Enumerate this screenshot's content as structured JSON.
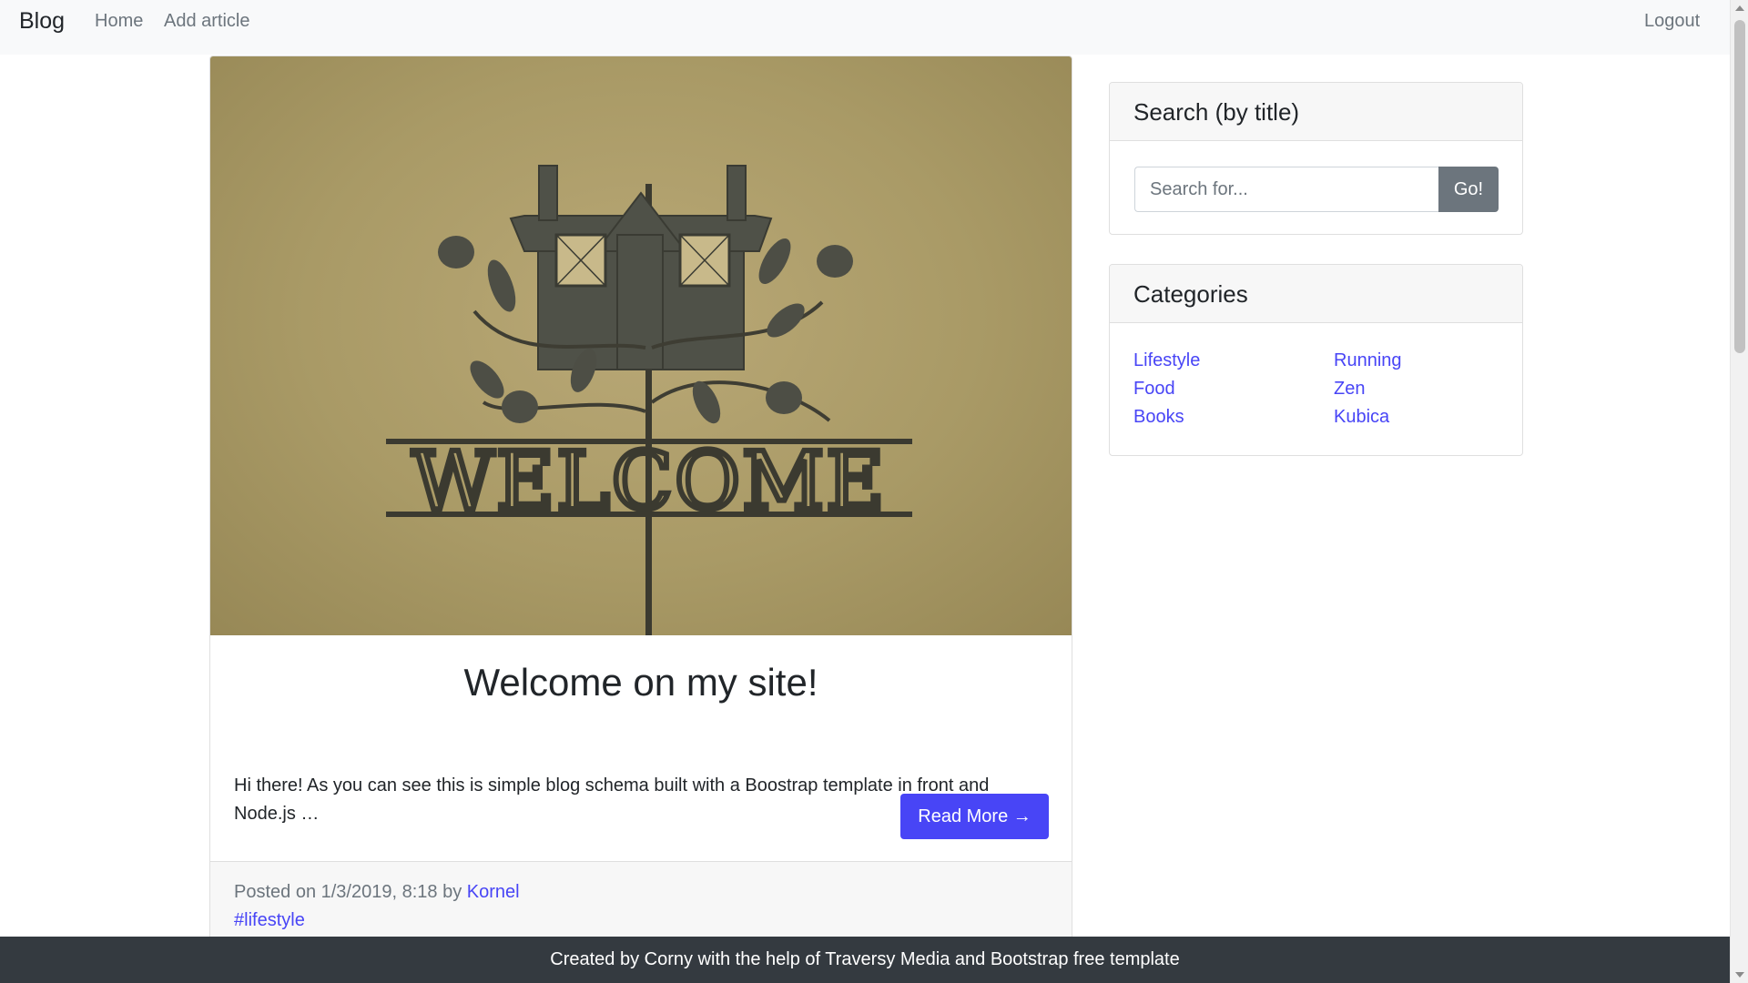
{
  "navbar": {
    "brand": "Blog",
    "links": [
      "Home",
      "Add article"
    ],
    "logout": "Logout"
  },
  "post": {
    "image_alt_text": "WELCOME",
    "title": "Welcome on my site!",
    "excerpt": "Hi there! As you can see this is simple blog schema built with a Boostrap template in front and Node.js …",
    "read_more": "Read More →",
    "posted_prefix": "Posted on 1/3/2019, 8:18 by",
    "author": "Kornel",
    "tag": "#lifestyle"
  },
  "search": {
    "header": "Search (by title)",
    "placeholder": "Search for...",
    "button": "Go!"
  },
  "categories": {
    "header": "Categories",
    "items": [
      "Lifestyle",
      "Food",
      "Books",
      "Running",
      "Zen",
      "Kubica"
    ]
  },
  "footer": {
    "text": "Created by Corny with the help of Traversy Media and Bootstrap free template"
  },
  "colors": {
    "accent": "#4845f6",
    "navbar_bg": "#f8f9fa",
    "footer_bg": "#343a40",
    "secondary_button": "#6c757d"
  }
}
